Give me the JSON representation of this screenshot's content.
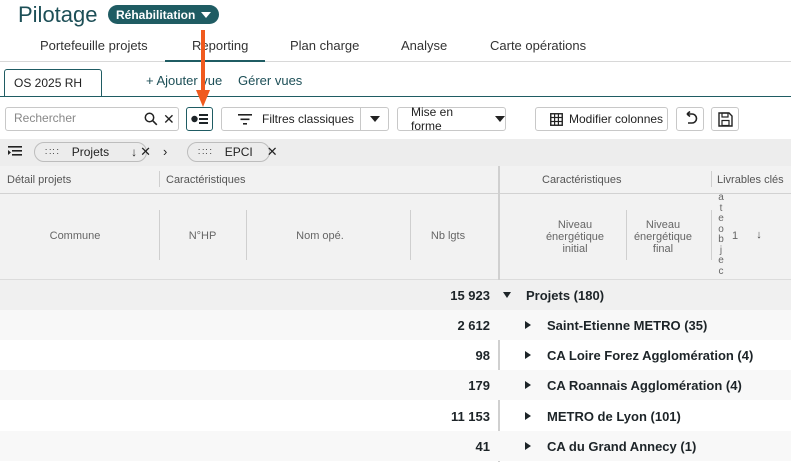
{
  "header": {
    "title": "Pilotage",
    "badge": "Réhabilitation"
  },
  "tabs": [
    {
      "label": "Portefeuille projets"
    },
    {
      "label": "Reporting"
    },
    {
      "label": "Plan charge"
    },
    {
      "label": "Analyse"
    },
    {
      "label": "Carte opérations"
    }
  ],
  "views": {
    "current": "OS 2025 RH",
    "add": "+ Ajouter vue",
    "manage": "Gérer vues"
  },
  "toolbar": {
    "search_placeholder": "Rechercher",
    "filters": "Filtres classiques",
    "format": "Mise en forme",
    "columns": "Modifier colonnes"
  },
  "grouping": [
    {
      "label": "Projets"
    },
    {
      "label": "EPCI"
    }
  ],
  "table": {
    "groups": {
      "detail": "Détail projets",
      "caracteristiques_left": "Caractéristiques",
      "caracteristiques_right": "Caractéristiques",
      "livrables": "Livrables clés"
    },
    "columns": {
      "commune": "Commune",
      "nhp": "N°HP",
      "nom": "Nom opé.",
      "nblgts": "Nb lgts",
      "niveau_initial": "Niveau énergétique initial",
      "niveau_final": "Niveau énergétique final",
      "vertical_letters": "ateobjec",
      "livrable_num": "1"
    },
    "total": {
      "nb": "15 923",
      "label": "Projets (180)"
    },
    "rows": [
      {
        "nb": "2 612",
        "label": "Saint-Etienne METRO (35)"
      },
      {
        "nb": "98",
        "label": "CA Loire Forez Agglomération (4)"
      },
      {
        "nb": "179",
        "label": "CA Roannais Agglomération (4)"
      },
      {
        "nb": "11 153",
        "label": "METRO de Lyon (101)"
      },
      {
        "nb": "41",
        "label": "CA du Grand Annecy (1)"
      }
    ]
  },
  "colors": {
    "brand": "#1f5c63",
    "annotation": "#f05a1e"
  }
}
